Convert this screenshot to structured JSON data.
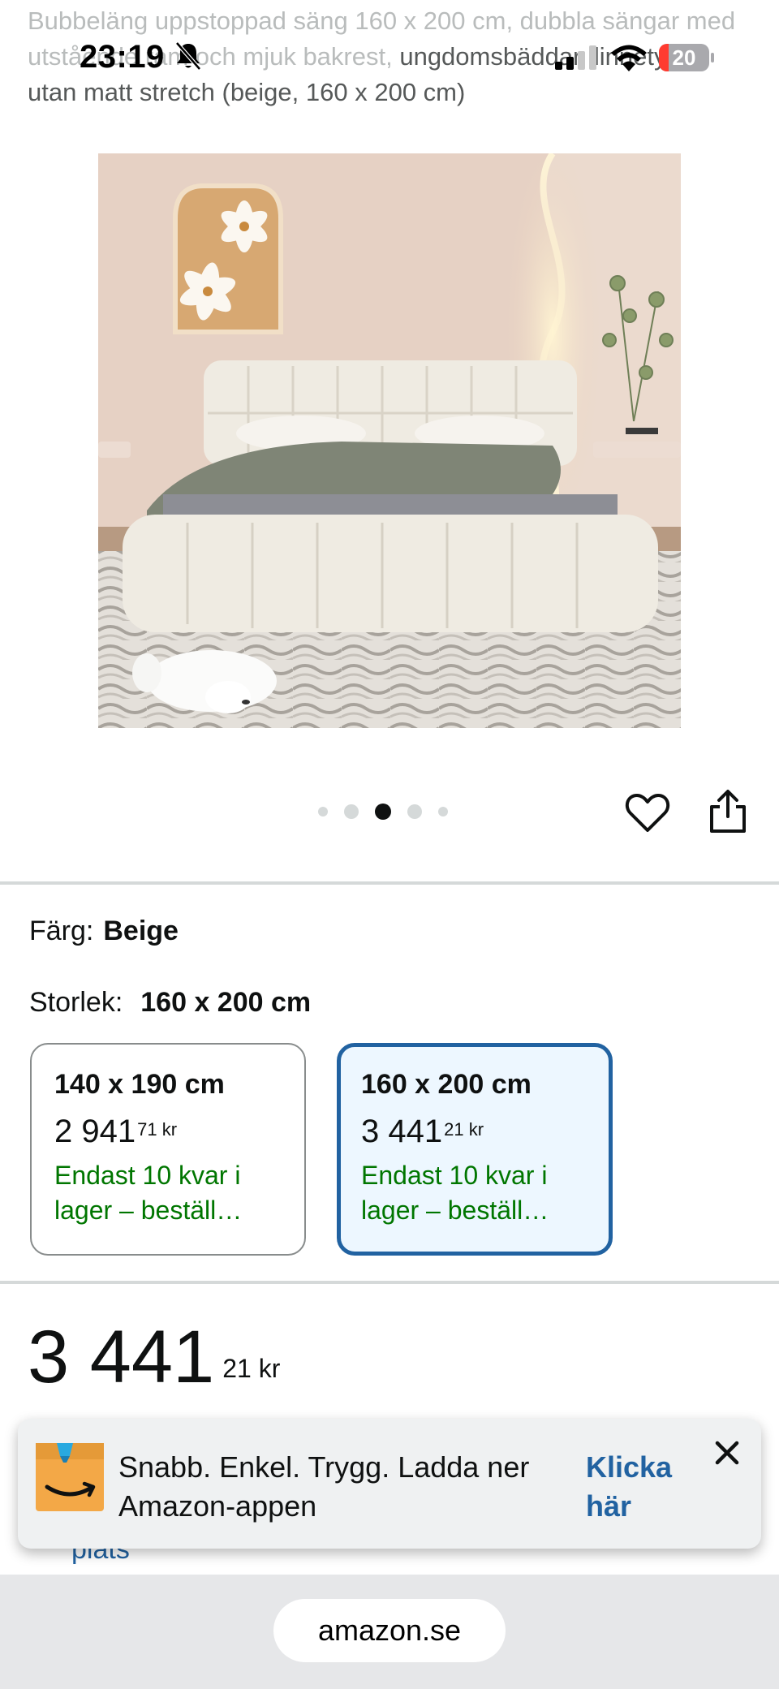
{
  "status_bar": {
    "time": "23:19",
    "battery": "20",
    "battery_level": 0.2,
    "icons": [
      "bell-slash-icon",
      "signal-icon",
      "wifi-icon",
      "battery-icon"
    ]
  },
  "product": {
    "title_faded": "Bubbeläng uppstoppad säng 160 x 200 cm, dubbla sängar med",
    "title_mid": " utstående ram och mjuk bakrest,",
    "title_rest": " ungdomsbäddar, linnetyg, utan matt stretch (beige, 160 x 200 cm)"
  },
  "gallery": {
    "dot_count": 5,
    "active_dot": 3,
    "icons": [
      "heart-icon",
      "share-icon"
    ]
  },
  "variation": {
    "color_label": "Färg:",
    "color_value": "Beige",
    "size_label": "Storlek:",
    "size_value": "160 x 200 cm",
    "sizes": [
      {
        "label": "140 x 190 cm",
        "price_whole": "2 941",
        "price_fraction": "71",
        "currency": "kr",
        "stock": "Endast 10 kvar i lager – beställ…",
        "selected": false
      },
      {
        "label": "160 x 200 cm",
        "price_whole": "3 441",
        "price_fraction": "21",
        "currency": "kr",
        "stock": "Endast 10 kvar i lager – beställ…",
        "selected": true
      }
    ]
  },
  "price": {
    "whole": "3 441",
    "fraction": "21",
    "currency": "kr"
  },
  "partial_link": "plats",
  "app_banner": {
    "text": "Snabb. Enkel. Trygg. Ladda ner Amazon-appen",
    "link": "Klicka här",
    "close": "✕"
  },
  "browser": {
    "url": "amazon.se"
  },
  "colors": {
    "link": "#2162a1",
    "stock_green": "#007600",
    "selected_bg": "#edf7ff",
    "amazon_box": "#f3a847"
  }
}
